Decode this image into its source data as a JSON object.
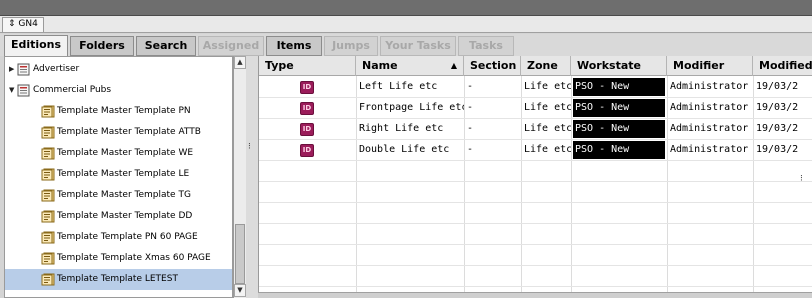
{
  "window": {
    "title": "GN4",
    "title_icon": "up-down-arrows-icon"
  },
  "tabs": [
    {
      "label": "Editions",
      "state": "active"
    },
    {
      "label": "Folders",
      "state": "normal"
    },
    {
      "label": "Search",
      "state": "normal"
    },
    {
      "label": "Assigned",
      "state": "disabled"
    },
    {
      "label": "Items",
      "state": "normal"
    },
    {
      "label": "Jumps",
      "state": "disabled"
    },
    {
      "label": "Your Tasks",
      "state": "disabled"
    },
    {
      "label": "Tasks",
      "state": "disabled"
    }
  ],
  "tree": {
    "items": [
      {
        "label": "Advertiser",
        "icon": "publication-icon",
        "expanded": false,
        "level": 0
      },
      {
        "label": "Commercial Pubs",
        "icon": "publication-icon",
        "expanded": true,
        "level": 0
      },
      {
        "label": "Template Master Template PN",
        "icon": "edition-template-icon",
        "level": 1
      },
      {
        "label": "Template Master Template ATTB",
        "icon": "edition-template-icon",
        "level": 1
      },
      {
        "label": "Template Master Template WE",
        "icon": "edition-template-icon",
        "level": 1
      },
      {
        "label": "Template Master Template LE",
        "icon": "edition-template-icon",
        "level": 1
      },
      {
        "label": "Template Master Template TG",
        "icon": "edition-template-icon",
        "level": 1
      },
      {
        "label": "Template Master Template DD",
        "icon": "edition-template-icon",
        "level": 1
      },
      {
        "label": "Template Template PN 60 PAGE",
        "icon": "edition-template-icon",
        "level": 1
      },
      {
        "label": "Template Template Xmas 60 PAGE",
        "icon": "edition-template-icon",
        "level": 1
      },
      {
        "label": "Template Template LETEST",
        "icon": "edition-template-icon",
        "level": 1,
        "selected": true
      }
    ]
  },
  "grid": {
    "columns": [
      {
        "label": "Type"
      },
      {
        "label": "Name",
        "sorted": "ascending"
      },
      {
        "label": "Section"
      },
      {
        "label": "Zone"
      },
      {
        "label": "Workstate"
      },
      {
        "label": "Modifier"
      },
      {
        "label": "Modified"
      }
    ],
    "rows": [
      {
        "type_icon": "indesign-document-icon",
        "type_badge": "ID",
        "name": "Left Life etc",
        "section": "-",
        "zone": "Life etc",
        "workstate": "PSO - New",
        "modifier": "Administrator",
        "modified": "19/03/2"
      },
      {
        "type_icon": "indesign-document-icon",
        "type_badge": "ID",
        "name": "Frontpage Life etc",
        "section": "-",
        "zone": "Life etc",
        "workstate": "PSO - New",
        "modifier": "Administrator",
        "modified": "19/03/2"
      },
      {
        "type_icon": "indesign-document-icon",
        "type_badge": "ID",
        "name": "Right Life etc",
        "section": "-",
        "zone": "Life etc",
        "workstate": "PSO - New",
        "modifier": "Administrator",
        "modified": "19/03/2"
      },
      {
        "type_icon": "indesign-document-icon",
        "type_badge": "ID",
        "name": "Double Life etc",
        "section": "-",
        "zone": "Life etc",
        "workstate": "PSO - New",
        "modifier": "Administrator",
        "modified": "19/03/2"
      }
    ]
  },
  "colors": {
    "selection": "#b8cde8",
    "workstate_bg": "#000000",
    "workstate_fg": "#ffffff",
    "type_icon": "#9b1c5a"
  }
}
